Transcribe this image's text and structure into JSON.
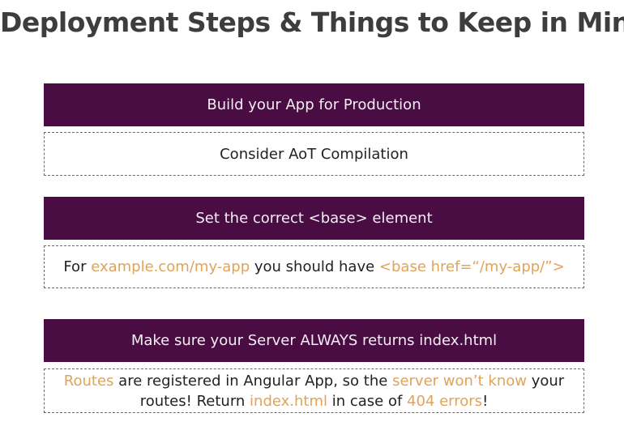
{
  "title": "Deployment Steps & Things to Keep in Mind",
  "steps": [
    {
      "header": "Build your App for Production",
      "note": {
        "text": "Consider AoT Compilation"
      }
    },
    {
      "header": "Set the correct <base> element",
      "note": {
        "t1": "For ",
        "h1": "example.com/my-app",
        "t2": " you should have ",
        "h2": "<base href=“/my-app/”>"
      }
    },
    {
      "header": "Make sure your Server ALWAYS returns index.html",
      "note": {
        "h1": "Routes",
        "t1": " are registered in Angular App, so the ",
        "h2": "server won’t know",
        "t2": " your routes! Return ",
        "h3": "index.html",
        "t3": " in case of ",
        "h4": "404 errors",
        "t4": "!"
      }
    }
  ],
  "colors": {
    "header_bg": "#4a0d43",
    "header_text": "#f4eef3",
    "highlight": "#e0a35a",
    "title": "#3d3d3d"
  }
}
